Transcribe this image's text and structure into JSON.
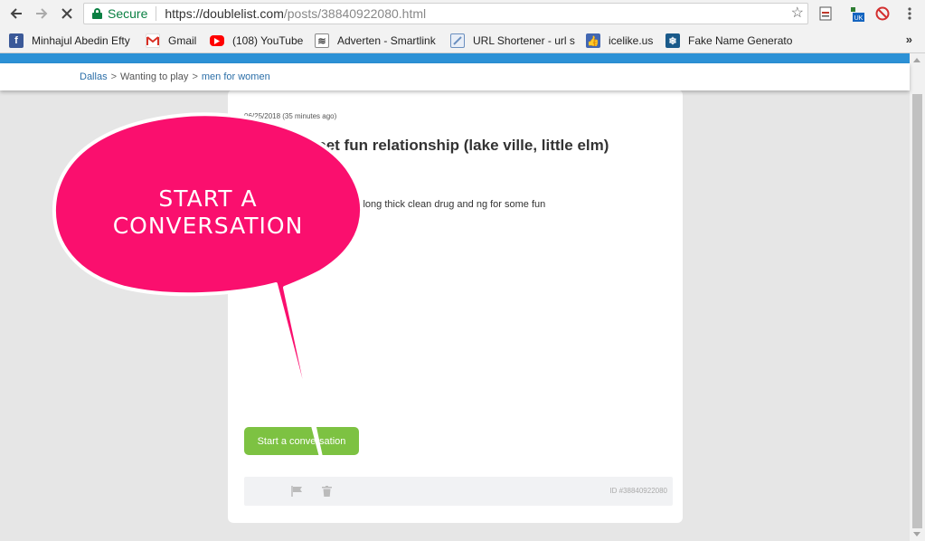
{
  "browser": {
    "secure_label": "Secure",
    "url_host": "https://doublelist.com",
    "url_path": "/posts/38840922080.html",
    "ext_badge": "UK"
  },
  "bookmarks": [
    {
      "label": "Minhajul Abedin Efty",
      "icon": "facebook-icon",
      "color": "#3b5998"
    },
    {
      "label": "Gmail",
      "icon": "gmail-icon",
      "color": "#d93025"
    },
    {
      "label": "(108) YouTube",
      "icon": "youtube-icon",
      "color": "#ff0000"
    },
    {
      "label": "Adverten - Smartlink",
      "icon": "adverten-icon",
      "color": "#444444"
    },
    {
      "label": "URL Shortener - url s",
      "icon": "url-shortener-icon",
      "color": "#6a8fbf"
    },
    {
      "label": "icelike.us",
      "icon": "icelike-icon",
      "color": "#4267b2"
    },
    {
      "label": "Fake Name Generato",
      "icon": "snowflake-icon",
      "color": "#1a5a8a"
    }
  ],
  "bookmarks_more": "»",
  "breadcrumb": {
    "city": "Dallas",
    "category": "Wanting to play",
    "section": "men for women",
    "separator": ">"
  },
  "post": {
    "meta": "06/25/2018 (35 minutes ago)",
    "title": "ior a discreet fun relationship (lake ville, little elm)",
    "body": "e brown hair blue eyes 7in long thick clean drug and ng for some fun",
    "cta": "Start a conversation",
    "id": "ID #38840922080"
  },
  "overlay": {
    "text_line1": "START A",
    "text_line2": "CONVERSATION",
    "color": "#fa0f6e"
  }
}
